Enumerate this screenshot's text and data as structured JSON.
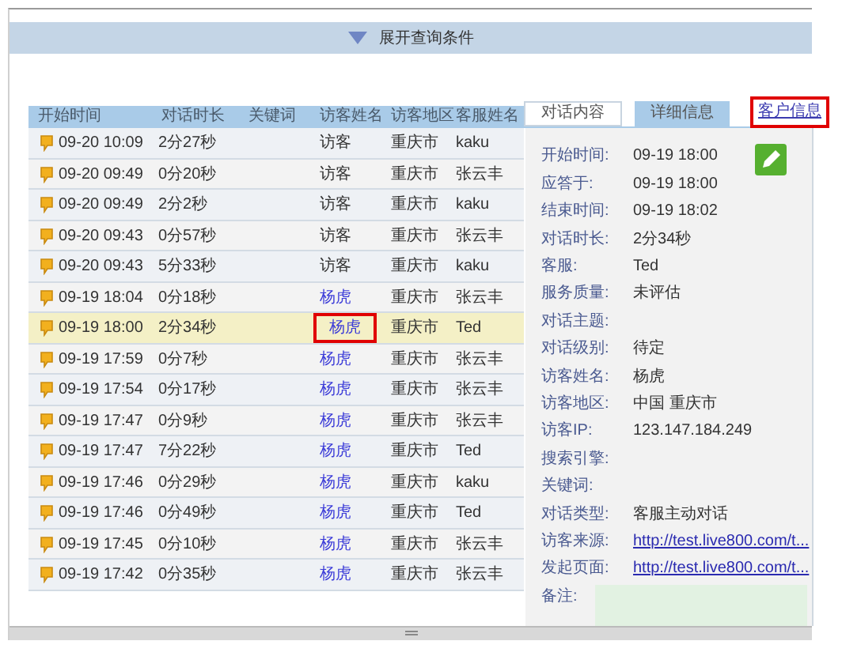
{
  "query_bar": {
    "label": "展开查询条件"
  },
  "table": {
    "columns": [
      "开始时间",
      "对话时长",
      "关键词",
      "访客姓名",
      "访客地区",
      "客服姓名"
    ],
    "rows": [
      {
        "start": "09-20 10:09",
        "duration": "2分27秒",
        "visitor": "访客",
        "linked": false,
        "region": "重庆市",
        "agent": "kaku",
        "selected": false,
        "highlighted": false
      },
      {
        "start": "09-20 09:49",
        "duration": "0分20秒",
        "visitor": "访客",
        "linked": false,
        "region": "重庆市",
        "agent": "张云丰",
        "selected": false,
        "highlighted": false
      },
      {
        "start": "09-20 09:49",
        "duration": "2分2秒",
        "visitor": "访客",
        "linked": false,
        "region": "重庆市",
        "agent": "kaku",
        "selected": false,
        "highlighted": false
      },
      {
        "start": "09-20 09:43",
        "duration": "0分57秒",
        "visitor": "访客",
        "linked": false,
        "region": "重庆市",
        "agent": "张云丰",
        "selected": false,
        "highlighted": false
      },
      {
        "start": "09-20 09:43",
        "duration": "5分33秒",
        "visitor": "访客",
        "linked": false,
        "region": "重庆市",
        "agent": "kaku",
        "selected": false,
        "highlighted": false
      },
      {
        "start": "09-19 18:04",
        "duration": "0分18秒",
        "visitor": "杨虎",
        "linked": true,
        "region": "重庆市",
        "agent": "张云丰",
        "selected": false,
        "highlighted": false
      },
      {
        "start": "09-19 18:00",
        "duration": "2分34秒",
        "visitor": "杨虎",
        "linked": true,
        "region": "重庆市",
        "agent": "Ted",
        "selected": true,
        "highlighted": true
      },
      {
        "start": "09-19 17:59",
        "duration": "0分7秒",
        "visitor": "杨虎",
        "linked": true,
        "region": "重庆市",
        "agent": "张云丰",
        "selected": false,
        "highlighted": false
      },
      {
        "start": "09-19 17:54",
        "duration": "0分17秒",
        "visitor": "杨虎",
        "linked": true,
        "region": "重庆市",
        "agent": "张云丰",
        "selected": false,
        "highlighted": false
      },
      {
        "start": "09-19 17:47",
        "duration": "0分9秒",
        "visitor": "杨虎",
        "linked": true,
        "region": "重庆市",
        "agent": "张云丰",
        "selected": false,
        "highlighted": false
      },
      {
        "start": "09-19 17:47",
        "duration": "7分22秒",
        "visitor": "杨虎",
        "linked": true,
        "region": "重庆市",
        "agent": "Ted",
        "selected": false,
        "highlighted": false
      },
      {
        "start": "09-19 17:46",
        "duration": "0分29秒",
        "visitor": "杨虎",
        "linked": true,
        "region": "重庆市",
        "agent": "kaku",
        "selected": false,
        "highlighted": false
      },
      {
        "start": "09-19 17:46",
        "duration": "0分49秒",
        "visitor": "杨虎",
        "linked": true,
        "region": "重庆市",
        "agent": "Ted",
        "selected": false,
        "highlighted": false
      },
      {
        "start": "09-19 17:45",
        "duration": "0分10秒",
        "visitor": "杨虎",
        "linked": true,
        "region": "重庆市",
        "agent": "张云丰",
        "selected": false,
        "highlighted": false
      },
      {
        "start": "09-19 17:42",
        "duration": "0分35秒",
        "visitor": "杨虎",
        "linked": true,
        "region": "重庆市",
        "agent": "张云丰",
        "selected": false,
        "highlighted": false
      }
    ]
  },
  "tabs": [
    {
      "label": "对话内容",
      "selected": false
    },
    {
      "label": "详细信息",
      "selected": true
    }
  ],
  "customer_link": {
    "label": "客户信息",
    "highlighted": true
  },
  "details": [
    {
      "kind": "text",
      "label": "开始时间:",
      "value": "09-19 18:00"
    },
    {
      "kind": "text",
      "label": "应答于:",
      "value": "09-19 18:00"
    },
    {
      "kind": "text",
      "label": "结束时间:",
      "value": "09-19 18:02"
    },
    {
      "kind": "text",
      "label": "对话时长:",
      "value": "2分34秒"
    },
    {
      "kind": "text",
      "label": "客服:",
      "value": "Ted"
    },
    {
      "kind": "text",
      "label": "服务质量:",
      "value": "未评估"
    },
    {
      "kind": "text",
      "label": "对话主题:"
    },
    {
      "kind": "text",
      "label": "对话级别:",
      "value": "待定"
    },
    {
      "kind": "text",
      "label": "访客姓名:",
      "value": "杨虎"
    },
    {
      "kind": "text",
      "label": "访客地区:",
      "value": "中国 重庆市"
    },
    {
      "kind": "text",
      "label": "访客IP:",
      "value": "123.147.184.249"
    },
    {
      "kind": "text",
      "label": "搜索引擎:"
    },
    {
      "kind": "text",
      "label": "关键词:"
    },
    {
      "kind": "text",
      "label": "对话类型:",
      "value": "客服主动对话"
    },
    {
      "kind": "link",
      "label": "访客来源:",
      "value": "http://test.live800.com/t..."
    },
    {
      "kind": "link",
      "label": "发起页面:",
      "value": "http://test.live800.com/t..."
    },
    {
      "kind": "note",
      "label": "备注:"
    }
  ]
}
